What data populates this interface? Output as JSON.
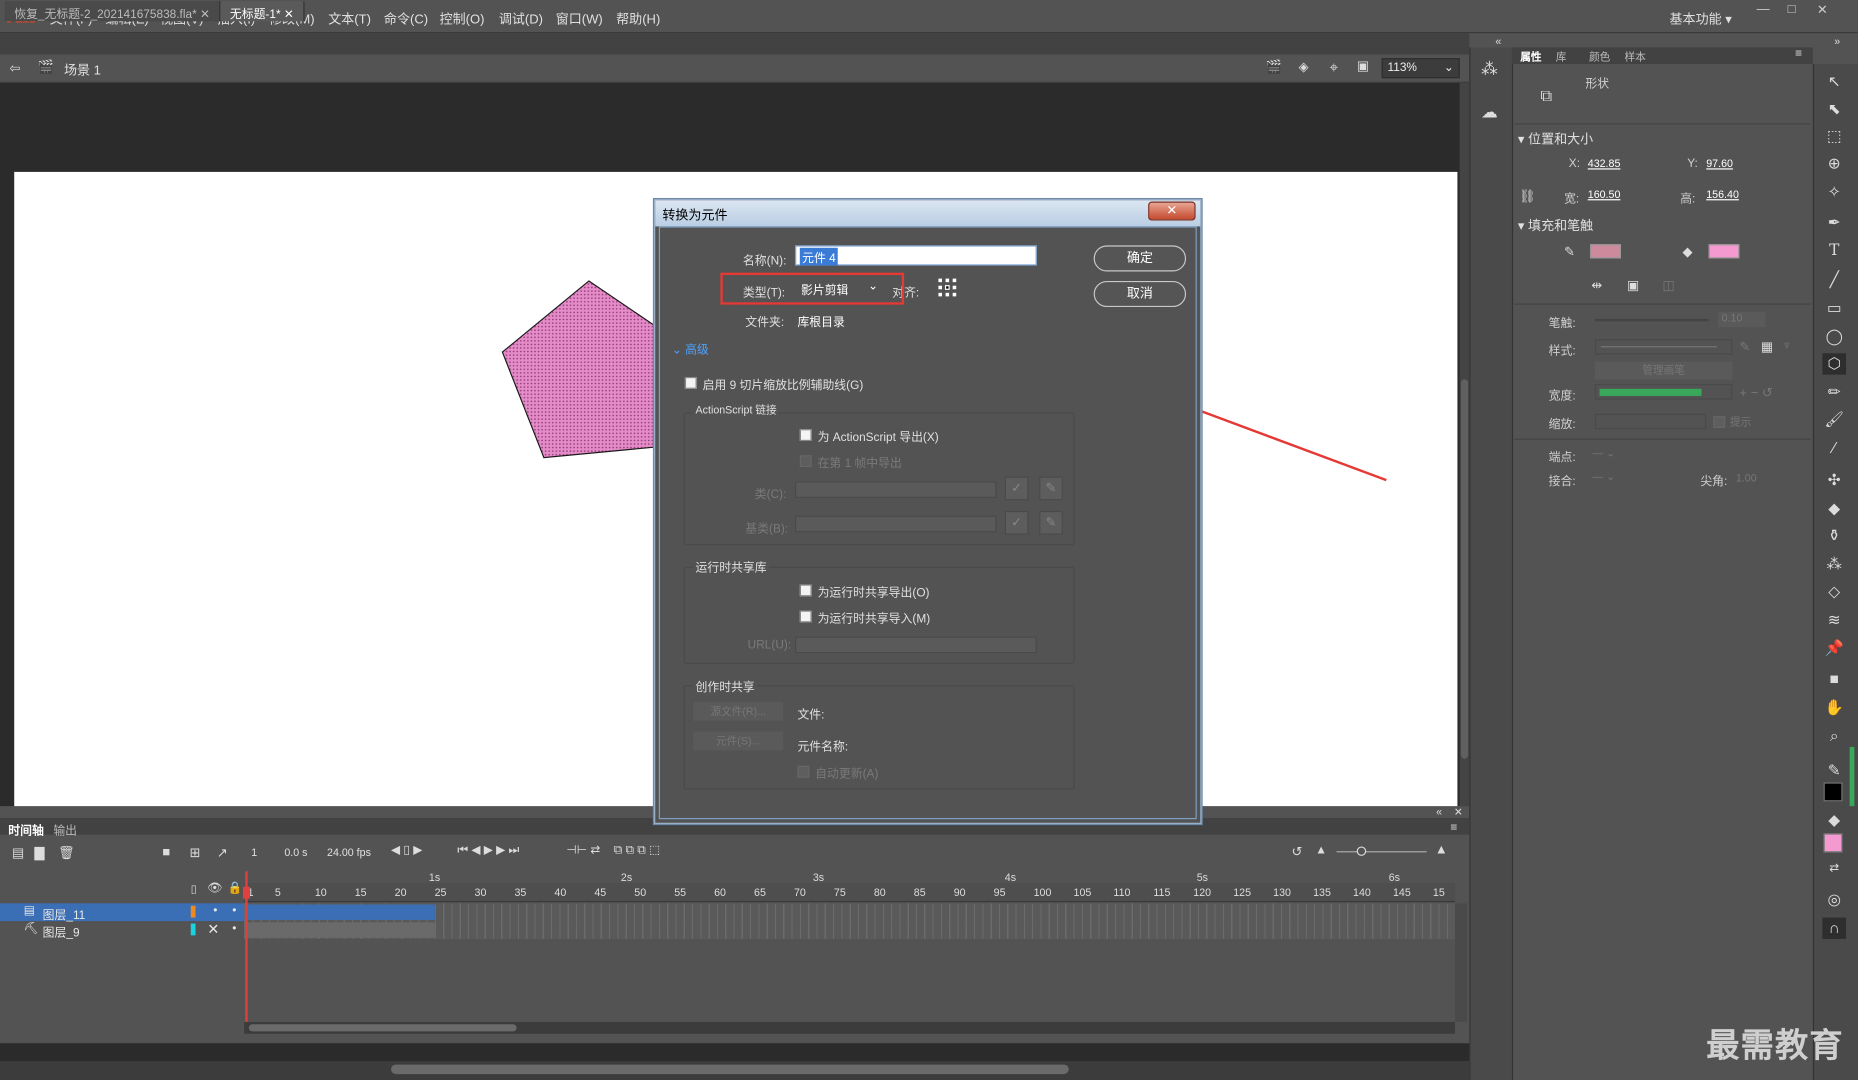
{
  "app": {
    "logo": "An",
    "workspace": "基本功能"
  },
  "menu": [
    "文件(F)",
    "编辑(E)",
    "视图(V)",
    "插入(I)",
    "修改(M)",
    "文本(T)",
    "命令(C)",
    "控制(O)",
    "调试(D)",
    "窗口(W)",
    "帮助(H)"
  ],
  "window_controls": {
    "min": "—",
    "max": "□",
    "close": "✕"
  },
  "tabs": [
    {
      "label": "恢复_无标题-2_202141675838.fla*"
    },
    {
      "label": "无标题-1*"
    }
  ],
  "scene": {
    "label": "场景 1",
    "zoom": "113%"
  },
  "properties": {
    "tabs": [
      "属性",
      "库",
      "颜色",
      "样本"
    ],
    "object_type": "形状",
    "section_pos": "位置和大小",
    "x_label": "X:",
    "x_val": "432.85",
    "y_label": "Y:",
    "y_val": "97.60",
    "w_label": "宽:",
    "w_val": "160.50",
    "h_label": "高:",
    "h_val": "156.40",
    "section_fill": "填充和笔触",
    "stroke_label": "笔触:",
    "stroke_val": "0.10",
    "style_label": "样式:",
    "manage_btn": "管理画笔",
    "width_label": "宽度:",
    "scale_label": "缩放:",
    "hint_label": "提示",
    "cap_label": "端点:",
    "join_label": "接合:",
    "miter_label": "尖角:",
    "miter_val": "1.00",
    "fill_color": "#f59ad0",
    "stroke_color": "#cc8a9c"
  },
  "timeline": {
    "tabs": [
      "时间轴",
      "输出"
    ],
    "frame": "1",
    "time": "0.0 s",
    "fps": "24.00 fps",
    "layers": [
      {
        "name": "图层_11",
        "color": "#f08a20"
      },
      {
        "name": "图层_9",
        "color": "#19d3e0"
      }
    ],
    "ruler_nums": [
      "1",
      "5",
      "10",
      "15",
      "20",
      "25",
      "30",
      "35",
      "40",
      "45",
      "50",
      "55",
      "60",
      "65",
      "70",
      "75",
      "80",
      "85",
      "90",
      "95",
      "100",
      "105",
      "110",
      "115",
      "120",
      "125",
      "130",
      "135",
      "140",
      "145",
      "15"
    ],
    "ruler_secs": [
      "1s",
      "2s",
      "3s",
      "4s",
      "5s",
      "6s"
    ]
  },
  "dialog": {
    "title": "转换为元件",
    "close": "✕",
    "name_label": "名称(N):",
    "name_val": "元件 4",
    "type_label": "类型(T):",
    "type_val": "影片剪辑",
    "align_label": "对齐:",
    "folder_label": "文件夹:",
    "folder_val": "库根目录",
    "advanced": "高级",
    "ok": "确定",
    "cancel": "取消",
    "enable9": "启用 9 切片缩放比例辅助线(G)",
    "as_title": "ActionScript 链接",
    "as_export": "为 ActionScript 导出(X)",
    "as_frame1": "在第 1 帧中导出",
    "class_label": "类(C):",
    "base_label": "基类(B):",
    "rsl_title": "运行时共享库",
    "rsl_export": "为运行时共享导出(O)",
    "rsl_import": "为运行时共享导入(M)",
    "url_label": "URL(U):",
    "auth_title": "创作时共享",
    "src_btn": "源文件(R)...",
    "sym_btn": "元件(S)...",
    "file_label": "文件:",
    "symname_label": "元件名称:",
    "auto_update": "自动更新(A)"
  },
  "watermark": "最需教育"
}
